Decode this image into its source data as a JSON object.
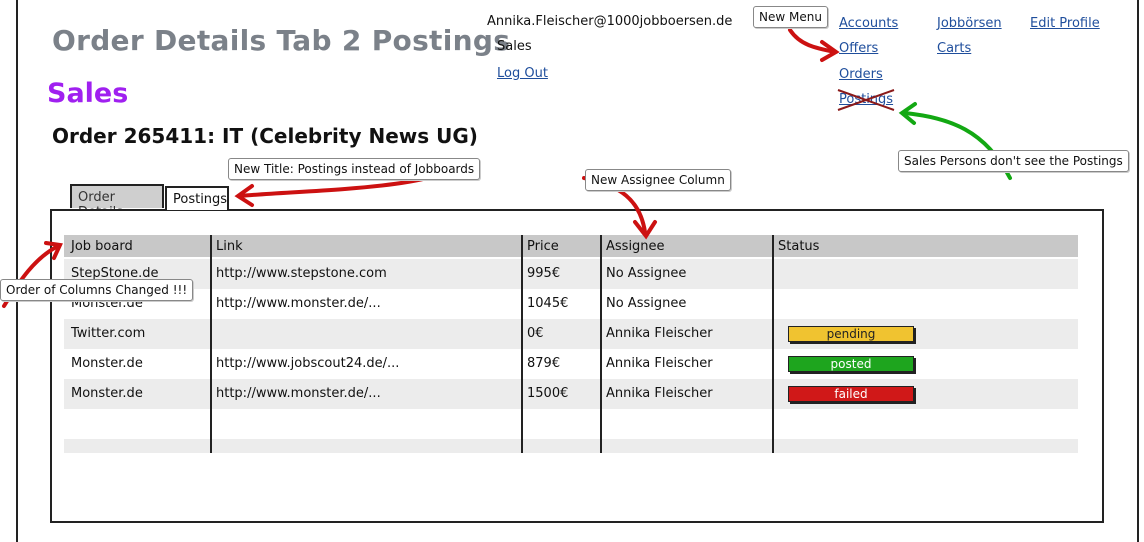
{
  "header": {
    "page_title": "Order Details Tab 2 Postings",
    "section_title": "Sales",
    "order_heading": "Order 265411: IT (Celebrity News UG)"
  },
  "user": {
    "email": "Annika.Fleischer@1000jobboersen.de",
    "role": "Sales",
    "logout": "Log Out"
  },
  "nav": {
    "accounts": "Accounts",
    "offers": "Offers",
    "orders": "Orders",
    "postings": "Postings",
    "jobboersen": "Jobbörsen",
    "carts": "Carts",
    "edit_profile": "Edit Profile"
  },
  "notes": {
    "new_menu": "New Menu",
    "new_title": "New Title: Postings instead of Jobboards",
    "new_assignee": "New Assignee Column",
    "sales_persons": "Sales Persons don't see the Postings",
    "order_columns": "Order of Columns Changed !!!"
  },
  "tabs": {
    "order_details": "Order Details",
    "postings": "Postings"
  },
  "table": {
    "columns": [
      "Job board",
      "Link",
      "Price",
      "Assignee",
      "Status"
    ],
    "rows": [
      {
        "job_board": "StepStone.de",
        "link": "http://www.stepstone.com",
        "price": "995€",
        "assignee": "No Assignee",
        "status": ""
      },
      {
        "job_board": "Monster.de",
        "link": "http://www.monster.de/...",
        "price": "1045€",
        "assignee": "No Assignee",
        "status": ""
      },
      {
        "job_board": "Twitter.com",
        "link": "",
        "price": "0€",
        "assignee": "Annika Fleischer",
        "status": "pending"
      },
      {
        "job_board": "Monster.de",
        "link": "http://www.jobscout24.de/...",
        "price": "879€",
        "assignee": "Annika Fleischer",
        "status": "posted"
      },
      {
        "job_board": "Monster.de",
        "link": "http://www.monster.de/...",
        "price": "1500€",
        "assignee": "Annika Fleischer",
        "status": "failed"
      }
    ]
  },
  "colors": {
    "section_title": "#a020f0",
    "link": "#1f4e9c",
    "pending": "#f0c330",
    "posted": "#1ea51e",
    "failed": "#d01818",
    "arrow_red": "#cc1111",
    "arrow_green": "#13a813"
  }
}
